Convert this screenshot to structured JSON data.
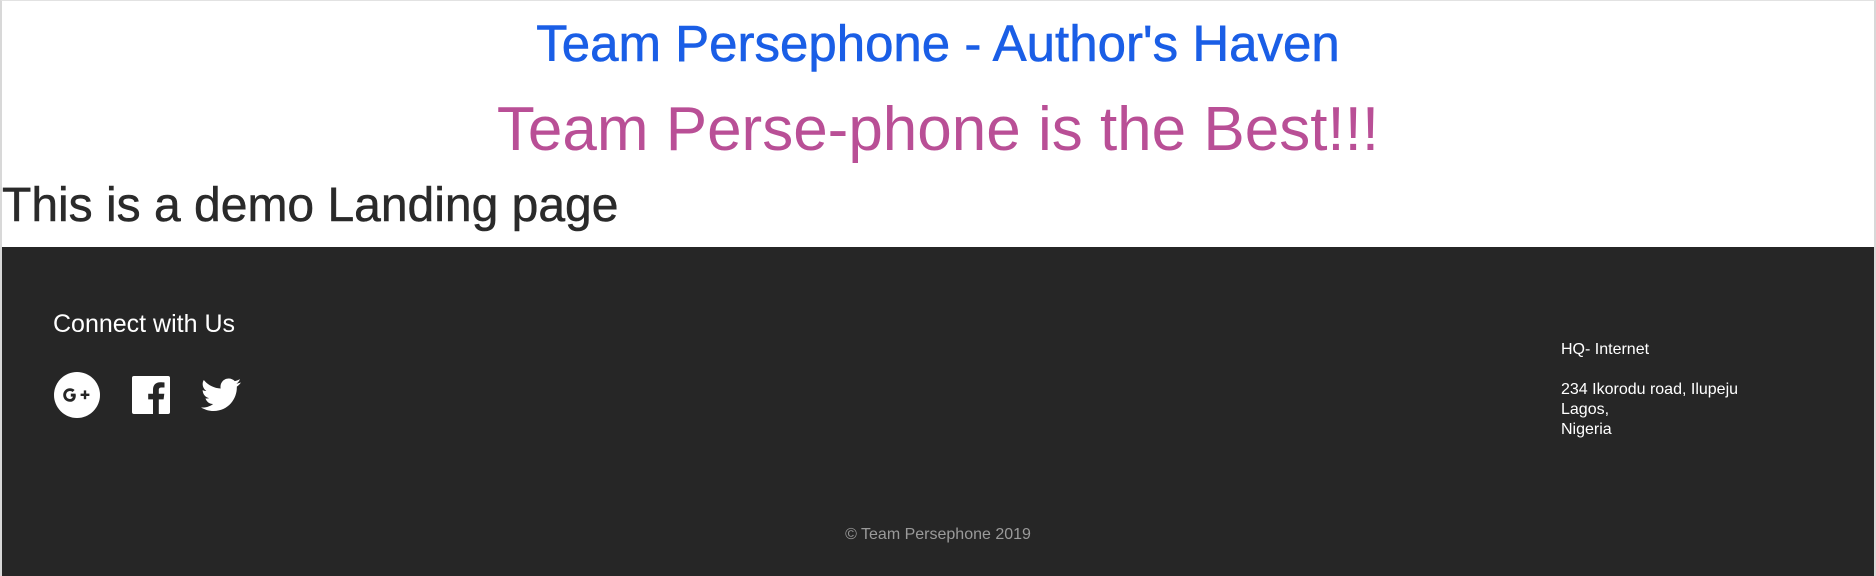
{
  "header": {
    "title": "Team Persephone - Author's Haven",
    "tagline": "Team Perse-phone is the Best!!!",
    "subheading": "This is a demo Landing page"
  },
  "footer": {
    "connect_heading": "Connect with Us",
    "social": [
      {
        "name": "google-plus",
        "icon": "google-plus-icon"
      },
      {
        "name": "facebook",
        "icon": "facebook-icon"
      },
      {
        "name": "twitter",
        "icon": "twitter-icon"
      }
    ],
    "address": {
      "hq": "HQ- Internet",
      "street": "234 Ikorodu road, Ilupeju",
      "city": "Lagos,",
      "country": "Nigeria"
    },
    "copyright": "© Team Persephone 2019"
  },
  "colors": {
    "title": "#1a5ee6",
    "tagline": "#b94f96",
    "subheading": "#2a2a2a",
    "footer_bg": "#262626",
    "copyright": "#9a9a9a"
  }
}
